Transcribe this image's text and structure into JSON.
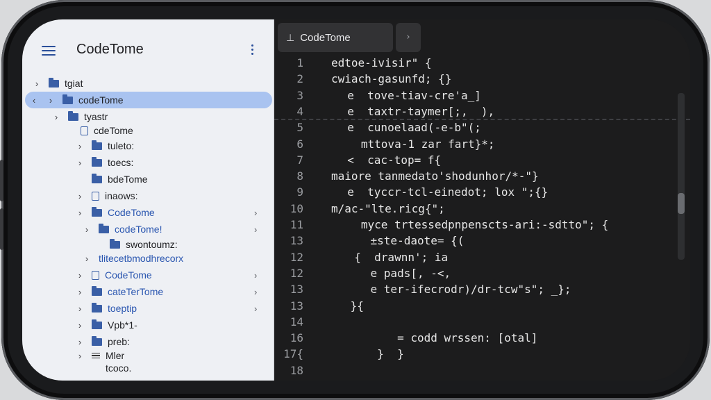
{
  "app": {
    "title": "CodeTome"
  },
  "tree": [
    {
      "label": "tgiat",
      "icon": "folder-icon",
      "chevron": "›"
    },
    {
      "label": "codeTome",
      "icon": "folder-icon",
      "chevron": "›",
      "selected": true,
      "back": "‹"
    },
    {
      "label": "tyastr",
      "icon": "folder-icon",
      "chevron": "›"
    },
    {
      "label": "cdeTome",
      "icon": "file-icon"
    },
    {
      "label": "tuleto:",
      "icon": "folder-icon",
      "chevron": "›"
    },
    {
      "label": "toecs:",
      "icon": "folder-icon",
      "chevron": "›"
    },
    {
      "label": "bdeTome",
      "icon": "folder-icon"
    },
    {
      "label": "inaows:",
      "icon": "file-icon",
      "chevron": "›"
    },
    {
      "label": "CodeTome",
      "icon": "folder-icon",
      "chevron": "›",
      "end": "›"
    },
    {
      "label": "codeTome!",
      "icon": "folder-icon",
      "chevron": "›",
      "end": "›"
    },
    {
      "label": "swontoumz:",
      "icon": "folder-icon"
    },
    {
      "label": "tlitecetbmodhrecorx",
      "icon": "none",
      "chevron": "›"
    },
    {
      "label": "CodeTome",
      "icon": "file-icon",
      "chevron": "›",
      "end": "›"
    },
    {
      "label": "cateTerTome",
      "icon": "folder-icon",
      "chevron": "›",
      "end": "›"
    },
    {
      "label": "toeptip",
      "icon": "folder-icon",
      "chevron": "›",
      "end": "›"
    },
    {
      "label": "Vpb*1-",
      "icon": "folder-icon",
      "chevron": "›"
    },
    {
      "label": "preb:",
      "icon": "folder-icon",
      "chevron": "›"
    },
    {
      "label": "Mler",
      "icon": "lines-icon",
      "chevron": "›"
    },
    {
      "label": "tcoco.",
      "icon": "none"
    }
  ],
  "editor": {
    "tab_label": "CodeTome",
    "tab_icon": "tab-icon",
    "lines": [
      {
        "num": "1",
        "text": "edtoe-ivisir\" {"
      },
      {
        "num": "2",
        "text": "cwiach-gasunfd; {}"
      },
      {
        "num": "3",
        "text": "  e  tove-tiav-cre'a_]"
      },
      {
        "num": "4",
        "text": "  e  taxtr-taymer[;,  ), "
      },
      {
        "num": "5",
        "text": "  e  cunoelaad(-e-b\"(;"
      },
      {
        "num": "6",
        "text": "   mttova-1 zar fart}*;"
      },
      {
        "num": "7",
        "text": "  <  cac-top= f{"
      },
      {
        "num": "8",
        "text": "maiore tanmedato'shodunhor/*-\"}"
      },
      {
        "num": "9",
        "text": "  e  tyccr-tcl-einedot; lox \";{}"
      },
      {
        "num": "10",
        "text": "m/ac-\"lte.ricg{\";"
      },
      {
        "num": "11",
        "text": "   myce trtessedpnpenscts-ari:-sdtto\"; {"
      },
      {
        "num": "13",
        "text": "    ±ste-daote= {("
      },
      {
        "num": "12",
        "text": "  {  drawnn'; ia"
      },
      {
        "num": "12",
        "text": "    e pads[, -<,"
      },
      {
        "num": "13",
        "text": "    e ter-ifecrodr)/dr-tcw\"s\"; _};"
      },
      {
        "num": "13",
        "text": " }{"
      },
      {
        "num": "14",
        "text": ""
      },
      {
        "num": "16",
        "text": "        = codd wrssen: [otal]"
      },
      {
        "num": "17{",
        "text": "     }  }"
      },
      {
        "num": "18",
        "text": ""
      }
    ]
  }
}
